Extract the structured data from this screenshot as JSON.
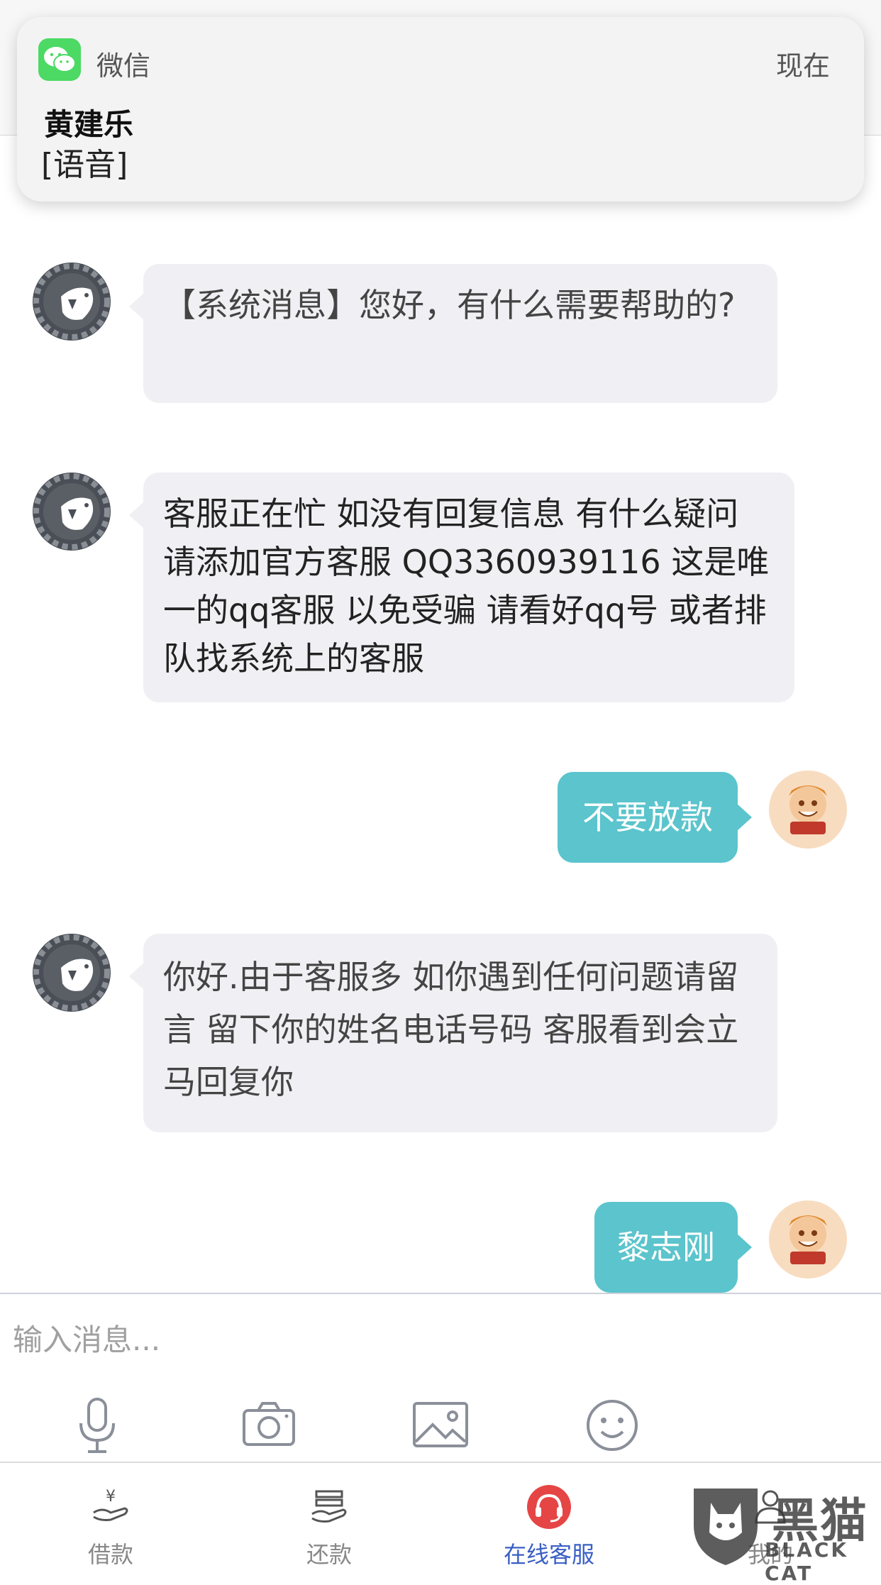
{
  "notification": {
    "app_name": "微信",
    "time": "现在",
    "sender": "黄建乐",
    "body": "[语音]"
  },
  "messages": [
    {
      "from": "bot",
      "text": "【系统消息】您好，有什么需要帮助的?"
    },
    {
      "from": "bot",
      "text": "客服正在忙 如没有回复信息  有什么疑问 请添加官方客服   QQ3360939116  这是唯一的qq客服    以免受骗 请看好qq号   或者排队找系统上的客服"
    },
    {
      "from": "user",
      "text": "不要放款"
    },
    {
      "from": "bot",
      "text": "你好.由于客服多   如你遇到任何问题请留言   留下你的姓名电话号码  客服看到会立马回复你"
    },
    {
      "from": "user",
      "text": "黎志刚"
    }
  ],
  "input": {
    "placeholder": "输入消息..."
  },
  "toolbar": {
    "icons": [
      "microphone-icon",
      "camera-icon",
      "image-icon",
      "emoji-icon"
    ]
  },
  "tabs": [
    {
      "label": "借款",
      "icon": "loan-icon",
      "active": false
    },
    {
      "label": "还款",
      "icon": "repay-icon",
      "active": false
    },
    {
      "label": "在线客服",
      "icon": "headset-icon",
      "active": true
    },
    {
      "label": "我的",
      "icon": "profile-icon",
      "active": false
    }
  ],
  "watermark": {
    "cn": "黑猫",
    "en": "BLACK CAT"
  },
  "colors": {
    "user_bubble": "#5bc4cc",
    "bot_bubble": "#f0f0f4",
    "active_tab": "#3a5fc4",
    "headset_badge": "#e64545"
  }
}
